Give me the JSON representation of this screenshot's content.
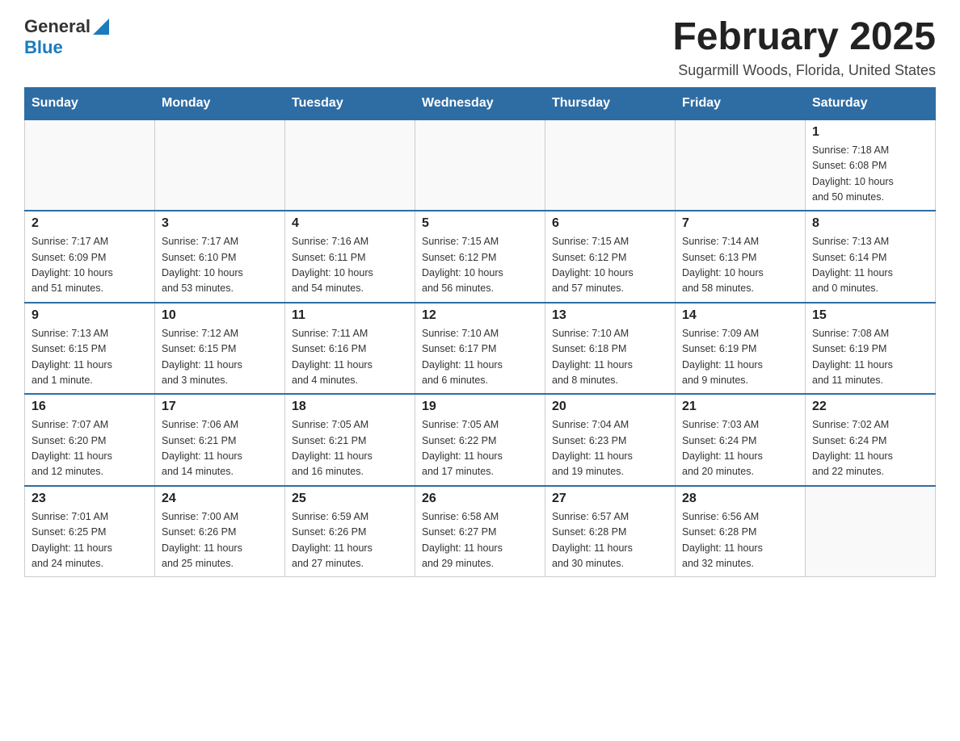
{
  "header": {
    "logo": {
      "general": "General",
      "blue": "Blue"
    },
    "title": "February 2025",
    "location": "Sugarmill Woods, Florida, United States"
  },
  "days_of_week": [
    "Sunday",
    "Monday",
    "Tuesday",
    "Wednesday",
    "Thursday",
    "Friday",
    "Saturday"
  ],
  "weeks": [
    [
      {
        "day": "",
        "info": ""
      },
      {
        "day": "",
        "info": ""
      },
      {
        "day": "",
        "info": ""
      },
      {
        "day": "",
        "info": ""
      },
      {
        "day": "",
        "info": ""
      },
      {
        "day": "",
        "info": ""
      },
      {
        "day": "1",
        "info": "Sunrise: 7:18 AM\nSunset: 6:08 PM\nDaylight: 10 hours\nand 50 minutes."
      }
    ],
    [
      {
        "day": "2",
        "info": "Sunrise: 7:17 AM\nSunset: 6:09 PM\nDaylight: 10 hours\nand 51 minutes."
      },
      {
        "day": "3",
        "info": "Sunrise: 7:17 AM\nSunset: 6:10 PM\nDaylight: 10 hours\nand 53 minutes."
      },
      {
        "day": "4",
        "info": "Sunrise: 7:16 AM\nSunset: 6:11 PM\nDaylight: 10 hours\nand 54 minutes."
      },
      {
        "day": "5",
        "info": "Sunrise: 7:15 AM\nSunset: 6:12 PM\nDaylight: 10 hours\nand 56 minutes."
      },
      {
        "day": "6",
        "info": "Sunrise: 7:15 AM\nSunset: 6:12 PM\nDaylight: 10 hours\nand 57 minutes."
      },
      {
        "day": "7",
        "info": "Sunrise: 7:14 AM\nSunset: 6:13 PM\nDaylight: 10 hours\nand 58 minutes."
      },
      {
        "day": "8",
        "info": "Sunrise: 7:13 AM\nSunset: 6:14 PM\nDaylight: 11 hours\nand 0 minutes."
      }
    ],
    [
      {
        "day": "9",
        "info": "Sunrise: 7:13 AM\nSunset: 6:15 PM\nDaylight: 11 hours\nand 1 minute."
      },
      {
        "day": "10",
        "info": "Sunrise: 7:12 AM\nSunset: 6:15 PM\nDaylight: 11 hours\nand 3 minutes."
      },
      {
        "day": "11",
        "info": "Sunrise: 7:11 AM\nSunset: 6:16 PM\nDaylight: 11 hours\nand 4 minutes."
      },
      {
        "day": "12",
        "info": "Sunrise: 7:10 AM\nSunset: 6:17 PM\nDaylight: 11 hours\nand 6 minutes."
      },
      {
        "day": "13",
        "info": "Sunrise: 7:10 AM\nSunset: 6:18 PM\nDaylight: 11 hours\nand 8 minutes."
      },
      {
        "day": "14",
        "info": "Sunrise: 7:09 AM\nSunset: 6:19 PM\nDaylight: 11 hours\nand 9 minutes."
      },
      {
        "day": "15",
        "info": "Sunrise: 7:08 AM\nSunset: 6:19 PM\nDaylight: 11 hours\nand 11 minutes."
      }
    ],
    [
      {
        "day": "16",
        "info": "Sunrise: 7:07 AM\nSunset: 6:20 PM\nDaylight: 11 hours\nand 12 minutes."
      },
      {
        "day": "17",
        "info": "Sunrise: 7:06 AM\nSunset: 6:21 PM\nDaylight: 11 hours\nand 14 minutes."
      },
      {
        "day": "18",
        "info": "Sunrise: 7:05 AM\nSunset: 6:21 PM\nDaylight: 11 hours\nand 16 minutes."
      },
      {
        "day": "19",
        "info": "Sunrise: 7:05 AM\nSunset: 6:22 PM\nDaylight: 11 hours\nand 17 minutes."
      },
      {
        "day": "20",
        "info": "Sunrise: 7:04 AM\nSunset: 6:23 PM\nDaylight: 11 hours\nand 19 minutes."
      },
      {
        "day": "21",
        "info": "Sunrise: 7:03 AM\nSunset: 6:24 PM\nDaylight: 11 hours\nand 20 minutes."
      },
      {
        "day": "22",
        "info": "Sunrise: 7:02 AM\nSunset: 6:24 PM\nDaylight: 11 hours\nand 22 minutes."
      }
    ],
    [
      {
        "day": "23",
        "info": "Sunrise: 7:01 AM\nSunset: 6:25 PM\nDaylight: 11 hours\nand 24 minutes."
      },
      {
        "day": "24",
        "info": "Sunrise: 7:00 AM\nSunset: 6:26 PM\nDaylight: 11 hours\nand 25 minutes."
      },
      {
        "day": "25",
        "info": "Sunrise: 6:59 AM\nSunset: 6:26 PM\nDaylight: 11 hours\nand 27 minutes."
      },
      {
        "day": "26",
        "info": "Sunrise: 6:58 AM\nSunset: 6:27 PM\nDaylight: 11 hours\nand 29 minutes."
      },
      {
        "day": "27",
        "info": "Sunrise: 6:57 AM\nSunset: 6:28 PM\nDaylight: 11 hours\nand 30 minutes."
      },
      {
        "day": "28",
        "info": "Sunrise: 6:56 AM\nSunset: 6:28 PM\nDaylight: 11 hours\nand 32 minutes."
      },
      {
        "day": "",
        "info": ""
      }
    ]
  ],
  "colors": {
    "header_bg": "#2e6da4",
    "header_text": "#ffffff",
    "border": "#2e6da4"
  }
}
